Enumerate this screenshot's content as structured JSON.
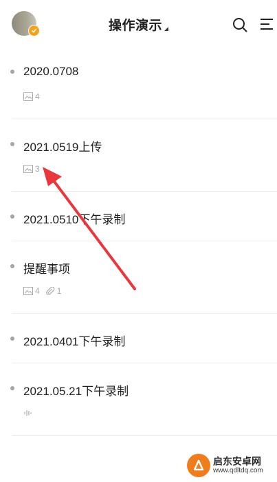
{
  "header": {
    "title": "操作演示",
    "search_icon": "search-icon",
    "menu_icon": "menu-icon"
  },
  "notes": [
    {
      "title": "2020.0708",
      "images": "4"
    },
    {
      "title": "2021.0519上传",
      "images": "3"
    },
    {
      "title": "2021.0510下午录制"
    },
    {
      "title": "提醒事项",
      "images": "4",
      "attachments": "1"
    },
    {
      "title": "2021.0401下午录制"
    },
    {
      "title": "2021.05.21下午录制",
      "audio_icon": "audio-wave-icon"
    }
  ],
  "annotation": {
    "arrow_color": "#e8383d"
  },
  "watermark": {
    "name": "启东安卓网",
    "url": "www.qdltdq.com"
  }
}
